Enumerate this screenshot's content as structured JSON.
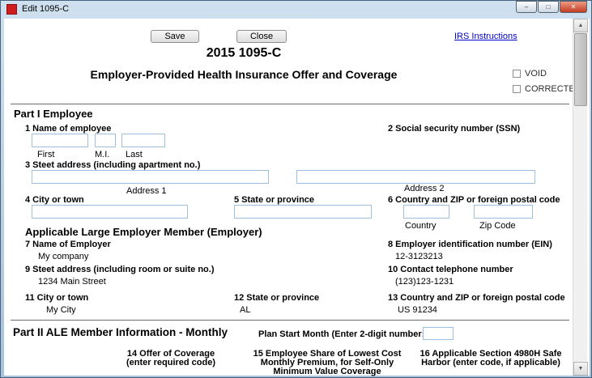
{
  "window": {
    "title": "Edit 1095-C",
    "icons": {
      "minimize": "–",
      "maximize": "□",
      "close": "✕",
      "scroll_up": "▲",
      "scroll_down": "▼"
    }
  },
  "toolbar": {
    "save": "Save",
    "close": "Close",
    "irs_link": "IRS Instructions"
  },
  "header": {
    "title": "2015 1095-C",
    "subtitle": "Employer-Provided Health Insurance Offer and Coverage",
    "void": "VOID",
    "corrected": "CORRECTED"
  },
  "part1": {
    "heading": "Part I Employee",
    "name_label": "1 Name of employee",
    "first": "First",
    "mi": "M.I.",
    "last": "Last",
    "ssn_label": "2 Social security number (SSN)",
    "street_label": "3 Steet address (including apartment no.)",
    "address1": "Address 1",
    "address2": "Address 2",
    "city_label": "4 City or town",
    "state_label": "5 State or province",
    "country_zip_label": "6 Country and ZIP or foreign postal code",
    "country": "Country",
    "zip": "Zip Code"
  },
  "employer": {
    "heading": "Applicable Large Employer Member (Employer)",
    "name_label": "7 Name of Employer",
    "name_value": "My company",
    "ein_label": "8 Employer identification number (EIN)",
    "ein_value": "12-3123213",
    "street_label": "9 Steet address (including room or suite no.)",
    "street_value": "1234 Main Street",
    "phone_label": "10 Contact telephone number",
    "phone_value": "(123)123-1231",
    "city_label": "11 City or town",
    "city_value": "My City",
    "state_label": "12 State or province",
    "state_value": "AL",
    "country_label": "13 Country and ZIP or foreign postal code",
    "country_value": "US 91234"
  },
  "part2": {
    "heading": "Part II ALE Member Information - Monthly",
    "plan_start_label": "Plan Start Month (Enter 2-digit number:)",
    "col14": "14 Offer of Coverage\n(enter required code)",
    "col15": "15 Employee Share of Lowest Cost\nMonthly Premium, for Self-Only\nMinimum Value Coverage",
    "col16": "16 Applicable Section 4980H Safe\nHarbor (enter code, if applicable)"
  },
  "colors": {
    "input_border": "#9ebfdd",
    "close_button": "#c23b22",
    "link": "#0000cc"
  }
}
